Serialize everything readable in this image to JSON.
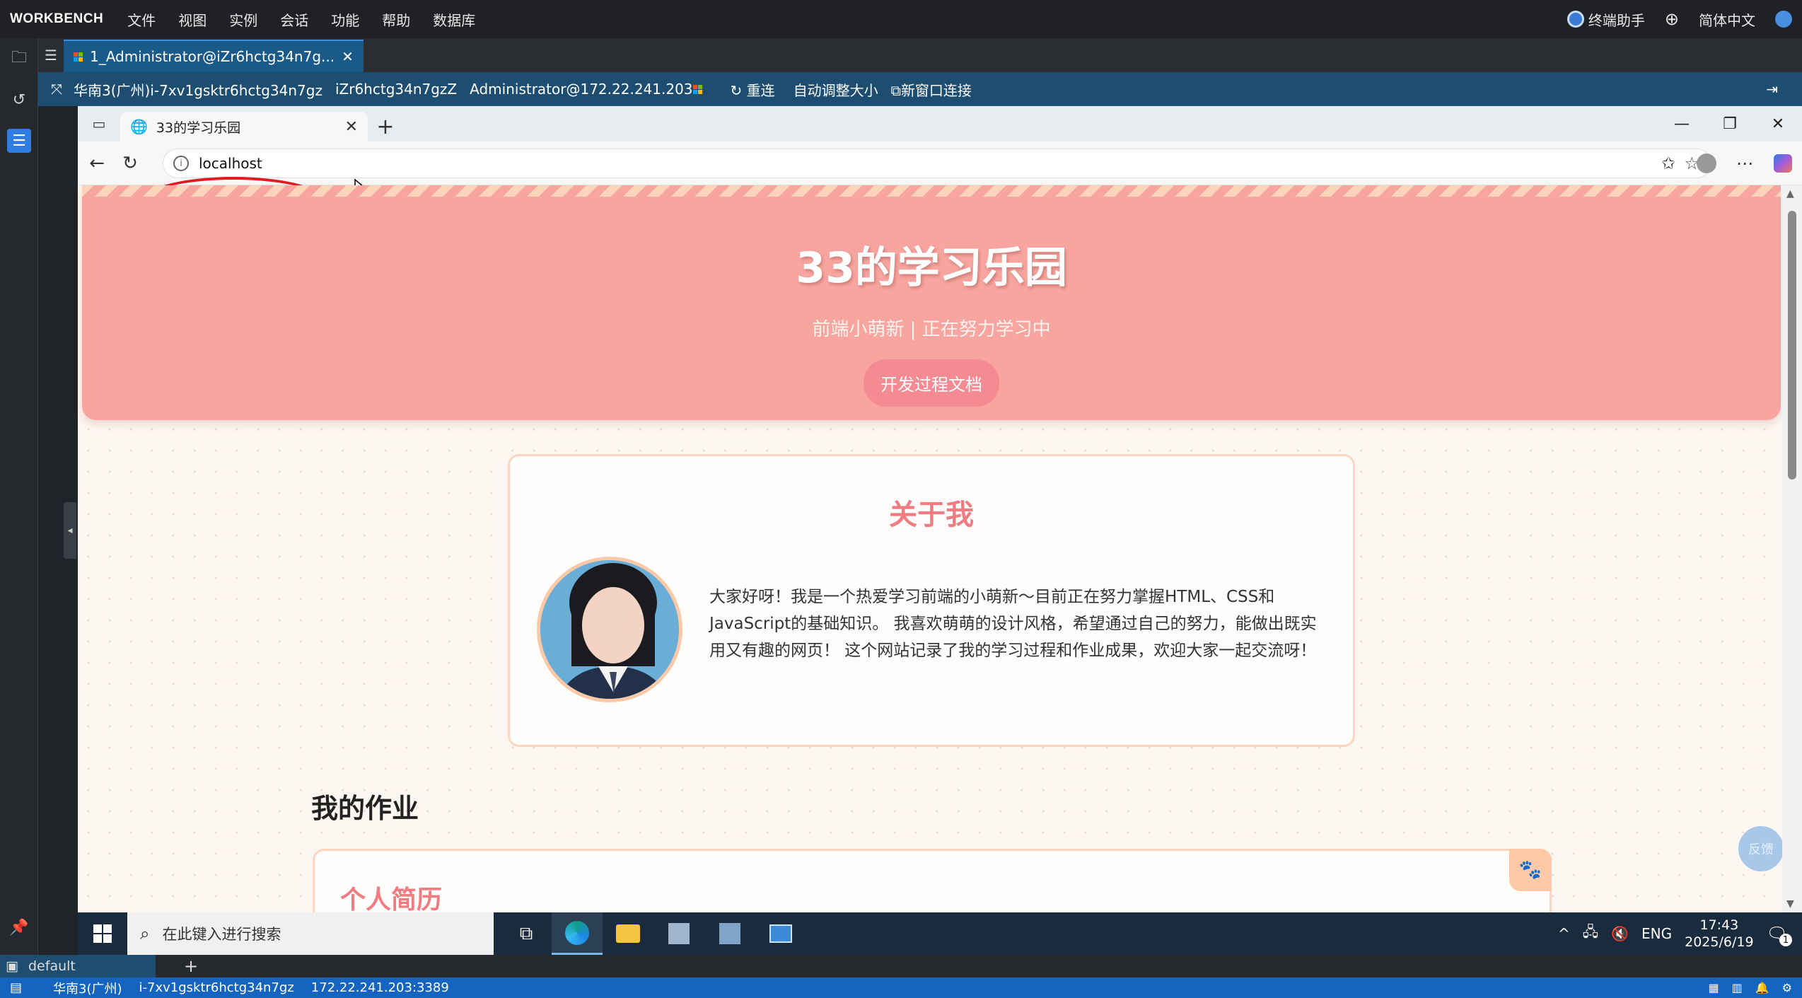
{
  "workbench": {
    "brand": "WORKBENCH",
    "menu": [
      "文件",
      "视图",
      "实例",
      "会话",
      "功能",
      "帮助",
      "数据库"
    ],
    "assistant": "终端助手",
    "language": "简体中文"
  },
  "session_tab": {
    "label": "1_Administrator@iZr6hctg34n7g..."
  },
  "connection": {
    "region_instance": "华南3(广州)i-7xv1gsktr6hctg34n7gz",
    "hostname": "iZr6hctg34n7gzZ",
    "user_host": "Administrator@172.22.241.203",
    "reconnect": "重连",
    "auto_resize": "自动调整大小",
    "new_window": "新窗口连接"
  },
  "browser": {
    "tab_title": "33的学习乐园",
    "url": "localhost"
  },
  "page": {
    "hero_title": "33的学习乐园",
    "hero_subtitle": "前端小萌新 | 正在努力学习中",
    "doc_button": "开发过程文档",
    "about_title": "关于我",
    "about_text": "大家好呀！我是一个热爱学习前端的小萌新～目前正在努力掌握HTML、CSS和JavaScript的基础知识。 我喜欢萌萌的设计风格，希望通过自己的努力，能做出既实用又有趣的网页！ 这个网站记录了我的学习过程和作业成果，欢迎大家一起交流呀！",
    "homework_title": "我的作业",
    "card_title": "个人简历",
    "feedback": "反馈"
  },
  "taskbar": {
    "search_placeholder": "在此键入进行搜索",
    "lang": "ENG",
    "time": "17:43",
    "date": "2025/6/19",
    "notifications": "1"
  },
  "workspace": {
    "tab": "default"
  },
  "status": {
    "region": "华南3(广州)",
    "instance": "i-7xv1gsktr6hctg34n7gz",
    "address": "172.22.241.203:3389"
  },
  "colors": {
    "hero": "#f8a5a0",
    "accent": "#f07b80",
    "status_blue": "#1565c0"
  }
}
